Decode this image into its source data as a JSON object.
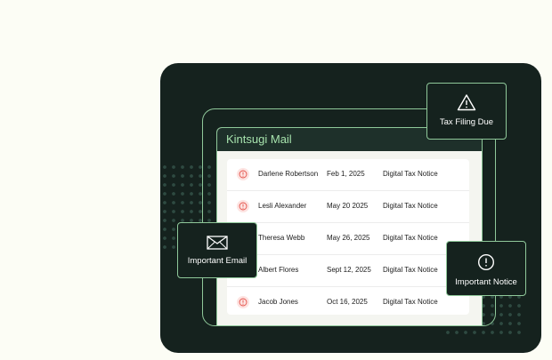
{
  "app": {
    "title": "Kintsugi Mail"
  },
  "emails": [
    {
      "name": "Darlene Robertson",
      "date": "Feb 1, 2025",
      "type": "Digital Tax Notice",
      "icon": "alert-circle-icon"
    },
    {
      "name": "Lesli Alexander",
      "date": "May 20 2025",
      "type": "Digital Tax Notice",
      "icon": "alert-circle-icon"
    },
    {
      "name": "Theresa Webb",
      "date": "May 26, 2025",
      "type": "Digital Tax Notice",
      "icon": "alert-circle-icon"
    },
    {
      "name": "Albert Flores",
      "date": "Sept 12, 2025",
      "type": "Digital Tax Notice",
      "icon": "alert-circle-icon"
    },
    {
      "name": "Jacob Jones",
      "date": "Oct 16, 2025",
      "type": "Digital Tax Notice",
      "icon": "alert-circle-icon"
    }
  ],
  "callouts": {
    "tax_filing": {
      "label": "Tax Filing Due",
      "icon": "warning-triangle-icon"
    },
    "important_email": {
      "label": "Important Email",
      "icon": "envelope-icon"
    },
    "important_notice": {
      "label": "Important Notice",
      "icon": "alert-circle-icon"
    }
  },
  "colors": {
    "background": "#fcfdf5",
    "dark_panel": "#15221e",
    "accent_green": "#8fc89a",
    "header_text": "#a7e3ad",
    "alert_red": "#e5534b"
  }
}
